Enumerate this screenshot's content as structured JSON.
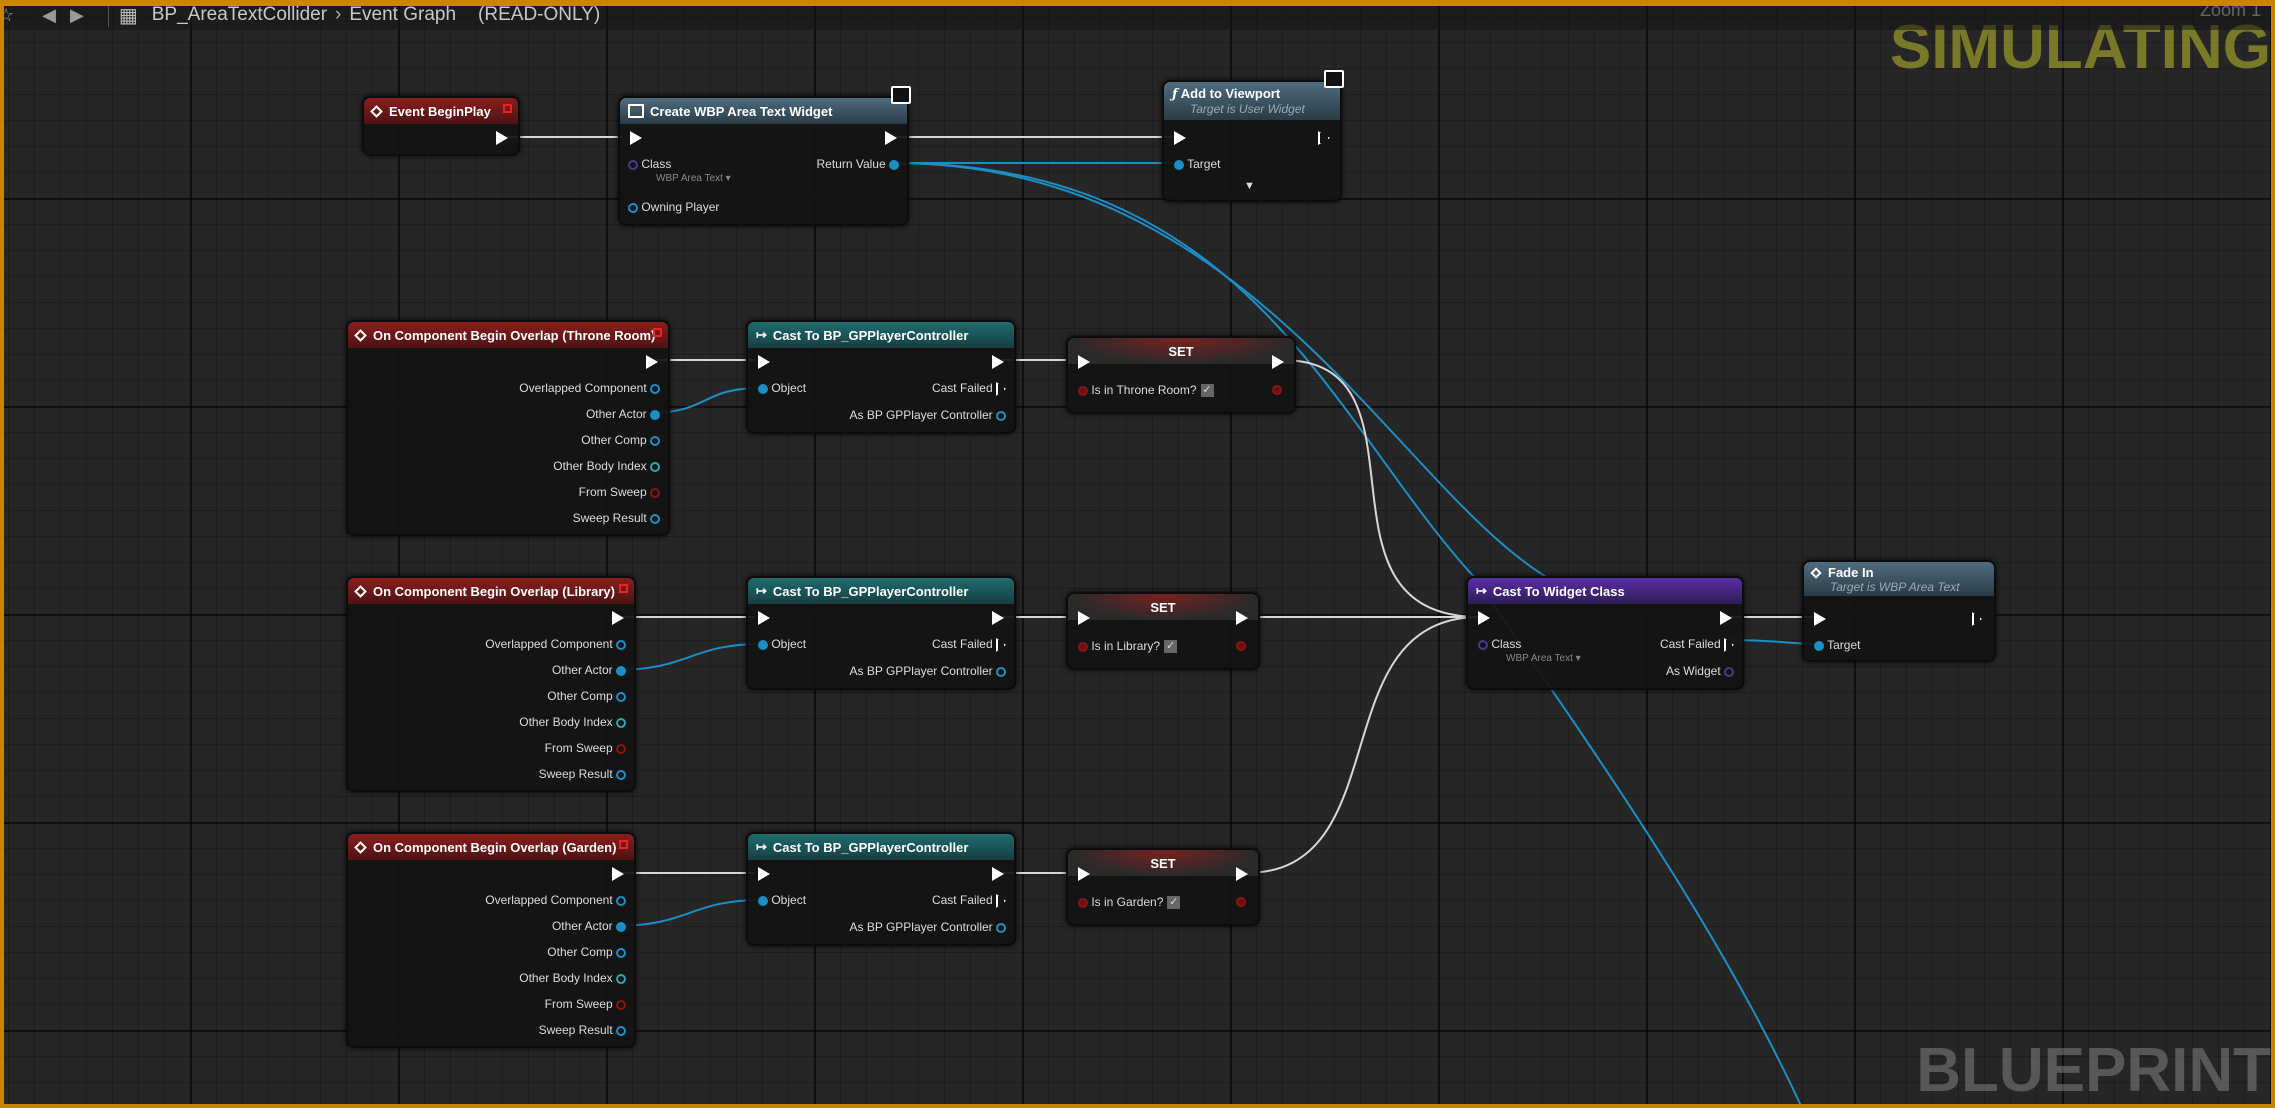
{
  "header": {
    "asset_name": "BP_AreaTextCollider",
    "graph_name": "Event Graph",
    "mode": "(READ-ONLY)",
    "zoom_label": "Zoom 1"
  },
  "watermarks": {
    "simulating": "SIMULATING",
    "blueprint": "BLUEPRINT"
  },
  "nodes": {
    "begin_play": {
      "title": "Event BeginPlay"
    },
    "create_widget": {
      "title": "Create WBP Area Text Widget",
      "class_label": "Class",
      "class_value": "WBP Area Text ▾",
      "return_value": "Return Value",
      "owning_player": "Owning Player"
    },
    "add_viewport": {
      "title": "Add to Viewport",
      "subtitle": "Target is User Widget",
      "target": "Target"
    },
    "overlap_throne": {
      "title": "On Component Begin Overlap (Throne Room)"
    },
    "overlap_library": {
      "title": "On Component Begin Overlap (Library)"
    },
    "overlap_garden": {
      "title": "On Component Begin Overlap (Garden)"
    },
    "overlap_pins": [
      "Overlapped Component",
      "Other Actor",
      "Other Comp",
      "Other Body Index",
      "From Sweep",
      "Sweep Result"
    ],
    "cast_pc": {
      "title": "Cast To BP_GPPlayerController",
      "object": "Object",
      "cast_failed": "Cast Failed",
      "as_pc": "As BP GPPlayer Controller"
    },
    "set_throne": {
      "title": "SET",
      "var": "Is in Throne Room?"
    },
    "set_library": {
      "title": "SET",
      "var": "Is in Library?"
    },
    "set_garden": {
      "title": "SET",
      "var": "Is in Garden?"
    },
    "cast_widget": {
      "title": "Cast To Widget Class",
      "class_label": "Class",
      "class_value": "WBP Area Text ▾",
      "cast_failed": "Cast Failed",
      "as_widget": "As Widget"
    },
    "fade_in": {
      "title": "Fade In",
      "subtitle": "Target is WBP Area Text",
      "target": "Target"
    }
  },
  "colors": {
    "exec_wire": "#d8d8d8",
    "object_wire": "#1b8fc6",
    "event_header": "#8a1e1e",
    "cast_header": "#1e6b6e",
    "frame": "#c98400"
  }
}
